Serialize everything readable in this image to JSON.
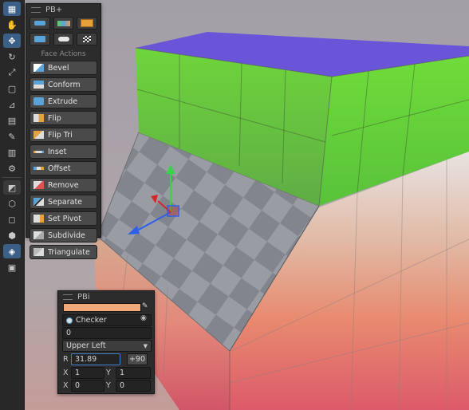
{
  "pb_panel": {
    "title": "PB+",
    "icons": [
      "shape-tools-icon",
      "material-editor-icon",
      "uv-brick-icon",
      "folder-uv-icon",
      "smoothing-icon",
      "checker-icon"
    ],
    "section": "Face Actions",
    "actions": [
      "Bevel",
      "Conform",
      "Extrude",
      "Flip",
      "Flip Tri",
      "Inset",
      "Offset",
      "Remove",
      "Separate",
      "Set Pivot",
      "Subdivide",
      "Triangulate"
    ]
  },
  "pbi_panel": {
    "title": "PBi",
    "color": "#f1a977",
    "material": "Checker",
    "value": "0",
    "anchor": "Upper Left",
    "rotation_label": "R",
    "rotation": "31.89",
    "rotate_button": "+90",
    "scale": {
      "x_label": "X",
      "x": "1",
      "y_label": "Y",
      "y": "1"
    },
    "offset": {
      "x_label": "X",
      "x": "0",
      "y_label": "Y",
      "y": "0"
    }
  },
  "colors": {
    "top_face": "#6a55d8",
    "green": "#61c93b",
    "checker_light": "#9ea0a7",
    "checker_dark": "#868891",
    "orange": "#f0a479",
    "pink": "#e36c7c",
    "axis_x": "#2d5fea",
    "axis_y": "#3ad24b",
    "axis_z": "#d52727"
  }
}
